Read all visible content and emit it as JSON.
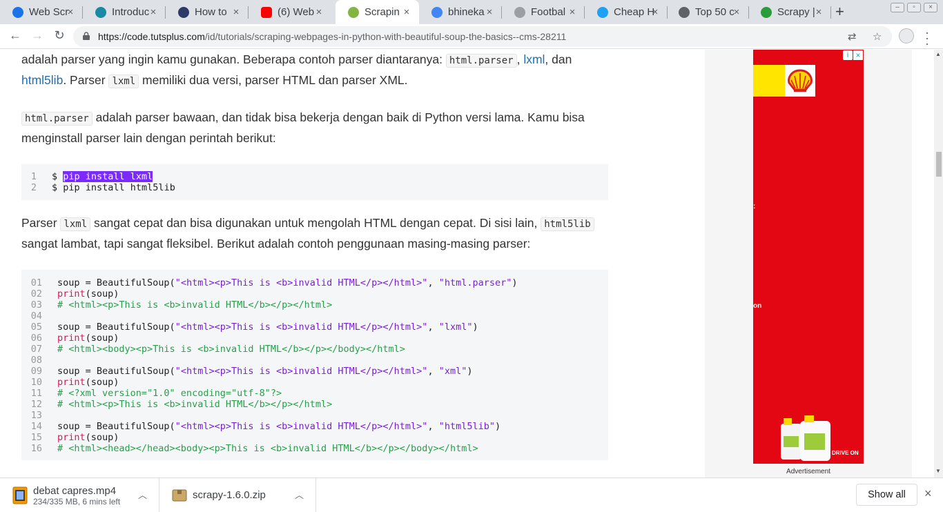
{
  "tabs": [
    {
      "label": "Web Scr",
      "icon": "chart-line-icon",
      "active": false
    },
    {
      "label": "Introduc",
      "icon": "lifebuoy-icon",
      "active": false
    },
    {
      "label": "How to",
      "icon": "pycharm-icon",
      "active": false
    },
    {
      "label": "(6) Web",
      "icon": "youtube-icon",
      "active": false
    },
    {
      "label": "Scrapin",
      "icon": "envato-leaf-icon",
      "active": true
    },
    {
      "label": "bhineka",
      "icon": "google-icon",
      "active": false
    },
    {
      "label": "Footbal",
      "icon": "page-icon",
      "active": false
    },
    {
      "label": "Cheap H",
      "icon": "bird-icon",
      "active": false
    },
    {
      "label": "Top 50 c",
      "icon": "image-icon",
      "active": false
    },
    {
      "label": "Scrapy |",
      "icon": "check-circle-icon",
      "active": false
    }
  ],
  "toolbar": {
    "url_host": "https://code.tutsplus.com",
    "url_path": "/id/tutorials/scraping-webpages-in-python-with-beautiful-soup-the-basics--cms-28211"
  },
  "article": {
    "p1_a": "adalah parser yang ingin kamu gunakan. Beberapa contoh parser diantaranya: ",
    "p1_code1": "html.parser",
    "p1_b": ", ",
    "p1_link1": "lxml",
    "p1_c": ", dan",
    "p1_link2": "html5lib",
    "p1_d": ". Parser ",
    "p1_code2": "lxml",
    "p1_e": " memiliki dua versi, parser HTML dan parser XML.",
    "p2_code": "html.parser",
    "p2_a": " adalah parser bawaan, dan tidak bisa bekerja dengan baik di Python versi lama. Kamu bisa menginstall parser lain dengan perintah berikut:",
    "p3_a": "Parser ",
    "p3_code1": "lxml",
    "p3_b": " sangat cepat dan bisa digunakan untuk mengolah HTML dengan cepat. Di sisi lain, ",
    "p3_code2": "html5lib",
    "p3_c": " sangat lambat, tapi sangat fleksibel. Berikut adalah contoh penggunaan masing-masing parser:"
  },
  "code1": [
    {
      "n": "1",
      "prefix": "$ ",
      "cmd": "pip install lxml",
      "selected": true
    },
    {
      "n": "2",
      "prefix": "$ ",
      "cmd": "pip install html5lib",
      "selected": false
    }
  ],
  "code2": [
    {
      "n": "01",
      "t": "assign",
      "a": "soup = BeautifulSoup(",
      "s": "\"<html><p>This is <b>invalid HTML</p></html>\"",
      "m": ", ",
      "s2": "\"html.parser\"",
      "e": ")"
    },
    {
      "n": "02",
      "t": "print",
      "kw": "print",
      "rest": "(soup)"
    },
    {
      "n": "03",
      "t": "comment",
      "c": "# <html><p>This is <b>invalid HTML</b></p></html>"
    },
    {
      "n": "04",
      "t": "blank"
    },
    {
      "n": "05",
      "t": "assign",
      "a": "soup = BeautifulSoup(",
      "s": "\"<html><p>This is <b>invalid HTML</p></html>\"",
      "m": ", ",
      "s2": "\"lxml\"",
      "e": ")"
    },
    {
      "n": "06",
      "t": "print",
      "kw": "print",
      "rest": "(soup)"
    },
    {
      "n": "07",
      "t": "comment",
      "c": "# <html><body><p>This is <b>invalid HTML</b></p></body></html>"
    },
    {
      "n": "08",
      "t": "blank"
    },
    {
      "n": "09",
      "t": "assign",
      "a": "soup = BeautifulSoup(",
      "s": "\"<html><p>This is <b>invalid HTML</p></html>\"",
      "m": ", ",
      "s2": "\"xml\"",
      "e": ")"
    },
    {
      "n": "10",
      "t": "print",
      "kw": "print",
      "rest": "(soup)"
    },
    {
      "n": "11",
      "t": "comment",
      "c": "# <?xml version=\"1.0\" encoding=\"utf-8\"?>"
    },
    {
      "n": "12",
      "t": "comment",
      "c": "# <html><p>This is <b>invalid HTML</b></p></html>"
    },
    {
      "n": "13",
      "t": "blank"
    },
    {
      "n": "14",
      "t": "assign",
      "a": "soup = BeautifulSoup(",
      "s": "\"<html><p>This is <b>invalid HTML</p></html>\"",
      "m": ", ",
      "s2": "\"html5lib\"",
      "e": ")"
    },
    {
      "n": "15",
      "t": "print",
      "kw": "print",
      "rest": "(soup)"
    },
    {
      "n": "16",
      "t": "comment",
      "c": "# <html><head></head><body><p>This is <b>invalid HTML</b></p></body></html>"
    }
  ],
  "ad": {
    "label": "Advertisement",
    "info": "i",
    "close": "×",
    "text1": ":",
    "text2": "on",
    "text3": "DRIVE ON",
    "colors": {
      "bg": "#e30613",
      "yellow": "#ffe500"
    }
  },
  "downloads": [
    {
      "name": "debat capres.mp4",
      "status": "234/335 MB, 6 mins left",
      "icon": "video-file-icon"
    },
    {
      "name": "scrapy-1.6.0.zip",
      "status": "",
      "icon": "archive-file-icon"
    }
  ],
  "shelf": {
    "show_all": "Show all",
    "close": "×"
  }
}
